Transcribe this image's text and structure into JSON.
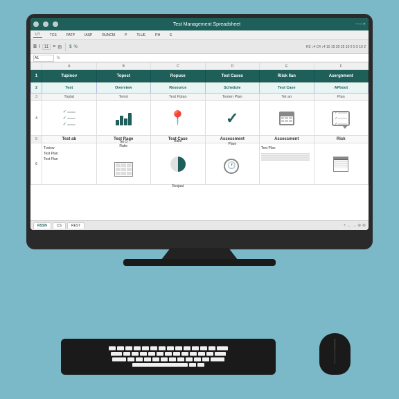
{
  "window": {
    "title": "Test Management Spreadsheet",
    "controls": [
      "minimize",
      "maximize",
      "close"
    ]
  },
  "ribbon": {
    "tabs": [
      "UT",
      "TCS",
      "PATP",
      "IASP",
      "RUNCM",
      "P",
      "TLUE",
      "PH",
      "E"
    ]
  },
  "formula_bar": {
    "cell_ref": "A1",
    "formula": ""
  },
  "col_headers": [
    "A",
    "B",
    "C",
    "D",
    "E",
    "F"
  ],
  "header_row": {
    "cells": [
      "Tupinov",
      "Topest",
      "Ropuce",
      "Test Cases",
      "Riisk Ilan",
      "Asergnment"
    ]
  },
  "sub_header_row": {
    "cells": [
      "Test",
      "Overview",
      "Resource",
      "Schedule",
      "Test Case",
      "APboot"
    ]
  },
  "sub_detail_row": {
    "cells": [
      "Toplat",
      "Tennt",
      "Test Pplan",
      "Testen Plan",
      "Tet an",
      "Plan"
    ]
  },
  "content_rows": [
    {
      "type": "icons",
      "cells": [
        "checklist",
        "bar-chart",
        "location-pin",
        "checkmark",
        "calendar",
        "chat-checklist"
      ]
    },
    {
      "type": "mixed",
      "label_cells": [
        "Test ab",
        "Test Rage",
        "Test Case",
        "Assessment",
        "Assessment",
        "Risk"
      ],
      "text_cells": [
        "Tuview\nTest Plan\nTest Plan",
        "Tet O\nRake",
        "Rake",
        "Plant",
        "Test Plan",
        ""
      ],
      "icon_cells": [
        null,
        "grid",
        "pie",
        "clock",
        null,
        "sheet"
      ]
    }
  ],
  "sheet_tabs": [
    "RSSN",
    "CS",
    "REST"
  ],
  "keyboard_rows": [
    [
      1,
      1,
      1,
      1,
      1,
      1,
      1,
      1,
      1,
      1,
      1,
      1,
      1
    ],
    [
      1,
      1,
      1,
      1,
      1,
      1,
      1,
      1,
      1,
      1,
      1,
      1,
      "wide"
    ],
    [
      "wide",
      1,
      1,
      1,
      1,
      1,
      1,
      1,
      1,
      1,
      1,
      "wide"
    ],
    [
      1,
      1,
      1,
      1,
      1,
      1,
      1,
      1,
      1,
      1,
      1,
      1
    ],
    [
      "space"
    ]
  ]
}
